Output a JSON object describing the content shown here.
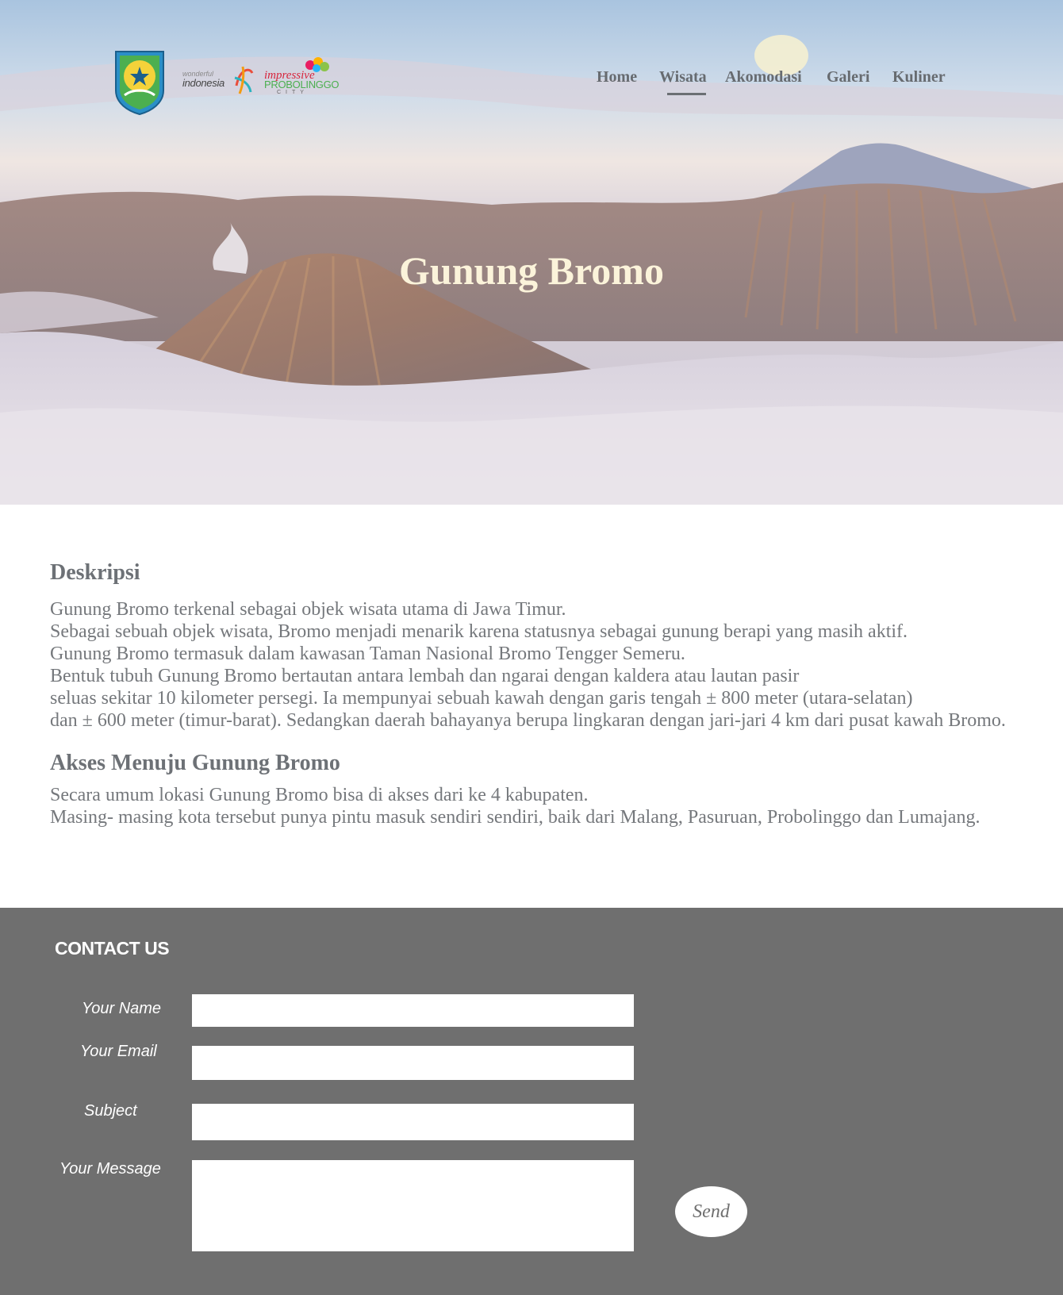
{
  "header": {
    "logos": {
      "wonderful_small": "wonderful",
      "wonderful_big": "indonesia",
      "probolinggo_top": "impressive",
      "probolinggo_mid": "PROBOLINGGO",
      "probolinggo_bot": "CITY"
    },
    "nav": [
      {
        "label": "Home"
      },
      {
        "label": "Wisata",
        "active": true
      },
      {
        "label": "Akomodasi"
      },
      {
        "label": "Galeri"
      },
      {
        "label": "Kuliner"
      }
    ]
  },
  "hero": {
    "title": "Gunung Bromo"
  },
  "content": {
    "deskripsi": {
      "title": "Deskripsi",
      "lines": [
        "Gunung Bromo terkenal sebagai objek wisata utama di Jawa Timur.",
        "Sebagai sebuah objek wisata, Bromo menjadi menarik karena statusnya sebagai gunung berapi yang masih aktif.",
        "Gunung Bromo termasuk dalam kawasan Taman Nasional Bromo Tengger Semeru.",
        "Bentuk tubuh Gunung Bromo bertautan antara lembah dan ngarai dengan kaldera atau lautan pasir",
        "seluas sekitar 10 kilometer persegi. Ia mempunyai sebuah kawah dengan garis tengah ± 800 meter (utara-selatan)",
        "dan ± 600 meter (timur-barat). Sedangkan daerah bahayanya berupa lingkaran dengan jari-jari 4 km dari pusat kawah Bromo."
      ]
    },
    "akses": {
      "title": "Akses Menuju Gunung Bromo",
      "lines": [
        "Secara umum lokasi Gunung Bromo bisa di akses dari ke 4 kabupaten.",
        "Masing- masing kota tersebut punya pintu masuk sendiri sendiri, baik dari Malang, Pasuruan, Probolinggo dan Lumajang."
      ]
    }
  },
  "footer": {
    "title": "CONTACT US",
    "form": {
      "name_label": "Your Name",
      "name_value": "",
      "email_label": "Your Email",
      "email_value": "",
      "subject_label": "Subject",
      "subject_value": "",
      "message_label": "Your Message",
      "message_value": "",
      "send_label": "Send"
    }
  },
  "colors": {
    "text_gray": "#73767a",
    "footer_bg": "#6f6f6f",
    "hero_title": "#fbf3da"
  }
}
